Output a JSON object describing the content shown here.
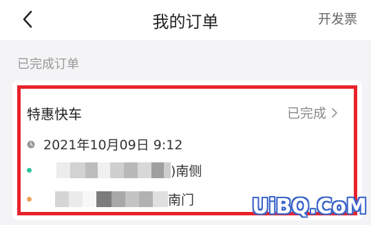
{
  "header": {
    "title": "我的订单",
    "invoice_label": "开发票"
  },
  "section": {
    "label": "已完成订单"
  },
  "order": {
    "ride_type": "特惠快车",
    "status": "已完成",
    "datetime": "2021年10月09日 9:12",
    "start_suffix": ")南侧",
    "end_suffix": "南门"
  },
  "colors": {
    "highlight_border": "#e8222a",
    "start_dot": "#2dc39b",
    "end_dot": "#f0a05a"
  },
  "icons": {
    "back": "chevron-left-icon",
    "status": "chevron-right-icon",
    "time": "clock-icon"
  },
  "watermark": "UiBQ.CoM"
}
